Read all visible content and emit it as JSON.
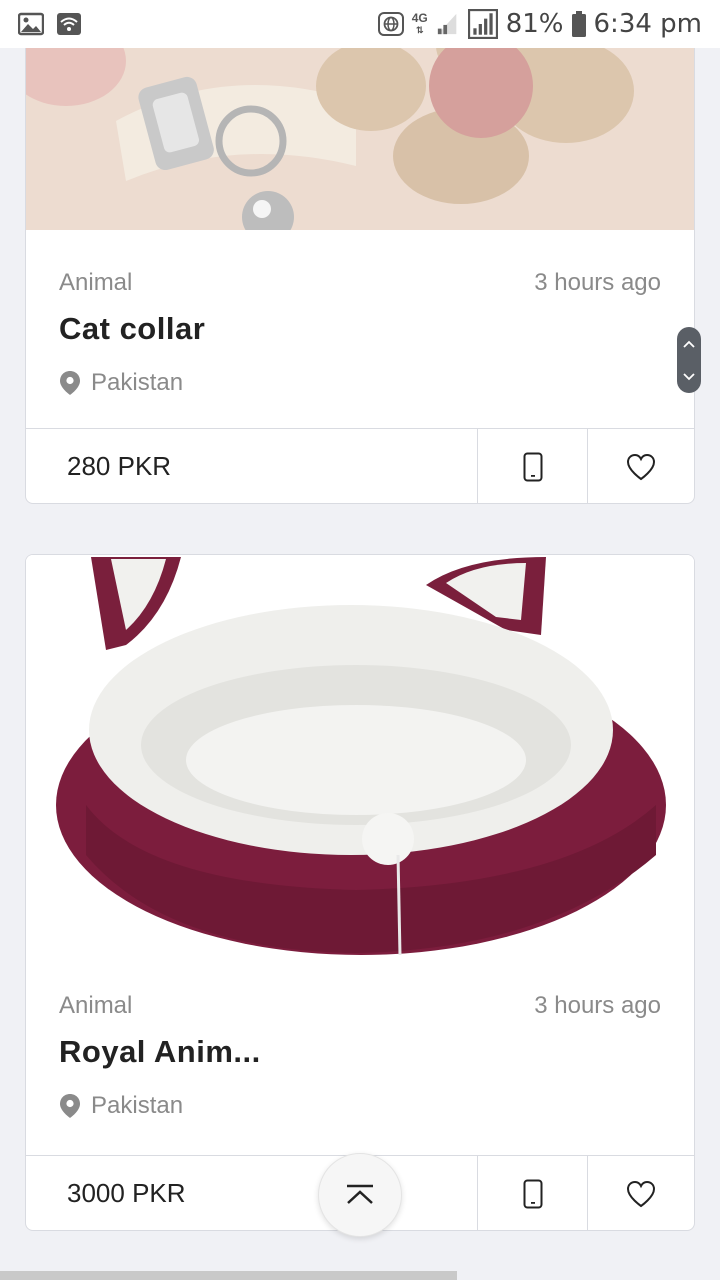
{
  "status_bar": {
    "network": "4G",
    "battery": "81%",
    "time": "6:34 pm"
  },
  "listings": [
    {
      "category": "Animal",
      "time_ago": "3 hours ago",
      "title": "Cat collar",
      "location": "Pakistan",
      "price": "280 PKR"
    },
    {
      "category": "Animal",
      "time_ago": "3 hours ago",
      "title": "Royal Anim...",
      "location": "Pakistan",
      "price": "3000 PKR"
    }
  ],
  "icons": {
    "gallery": "image-icon",
    "wifi": "wifi-icon",
    "globe": "globe-icon",
    "signal": "signal-icon",
    "battery": "battery-icon",
    "location": "map-pin-icon",
    "phone": "phone-icon",
    "favorite": "heart-icon",
    "back_to_top": "chevron-up-icon"
  },
  "colors": {
    "background": "#f0f1f5",
    "card": "#ffffff",
    "border": "#d9dbe1",
    "muted_text": "#8a8a8a"
  }
}
